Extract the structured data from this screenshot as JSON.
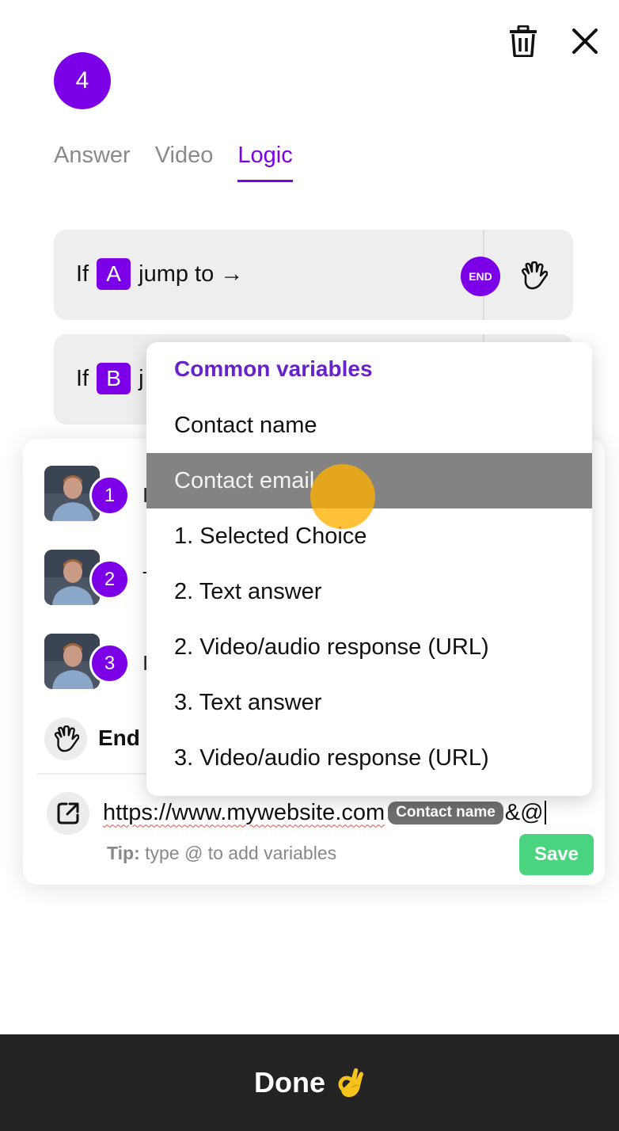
{
  "header": {
    "step_number": "4",
    "delete_icon": "trash-icon",
    "close_icon": "close-icon"
  },
  "tabs": [
    {
      "label": "Answer",
      "active": false
    },
    {
      "label": "Video",
      "active": false
    },
    {
      "label": "Logic",
      "active": true
    }
  ],
  "logic_rules": [
    {
      "prefix": "If",
      "choice": "A",
      "suffix": "jump to →",
      "target": "END",
      "target_icon": "waving-hand-icon"
    },
    {
      "prefix": "If",
      "choice": "B",
      "suffix": "j"
    }
  ],
  "jump_panel": {
    "steps": [
      {
        "number": "1",
        "label": "I"
      },
      {
        "number": "2",
        "label": "T"
      },
      {
        "number": "3",
        "label": "I"
      }
    ],
    "end_label": "End",
    "url": {
      "text": "https://www.mywebsite.com",
      "variable_chip": "Contact name",
      "suffix": "&@"
    },
    "tip_label": "Tip:",
    "tip_text": " type @ to add variables",
    "save_label": "Save"
  },
  "variables_dropdown": {
    "header": "Common variables",
    "items": [
      "Contact name",
      "Contact email",
      "1. Selected Choice",
      "2. Text answer",
      "2. Video/audio response (URL)",
      "3. Text answer",
      "3. Video/audio response (URL)"
    ],
    "hovered_index": 1
  },
  "footer": {
    "done_label": "Done",
    "done_emoji": "ok-hand-icon"
  },
  "colors": {
    "accent": "#7b00e8",
    "save": "#4bd47f",
    "footer_bg": "#232323",
    "hover_bg": "#838383",
    "cursor": "#ffb000"
  }
}
